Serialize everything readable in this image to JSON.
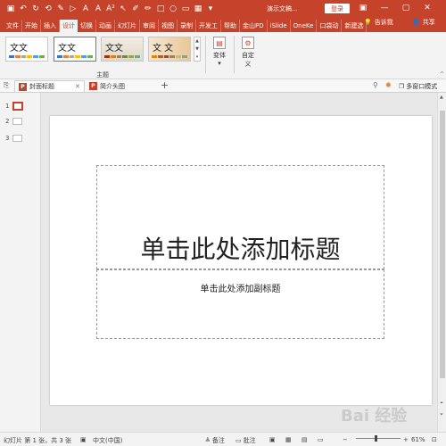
{
  "titlebar": {
    "doc_title": "演示文稿...",
    "login_label": "登录"
  },
  "tabs": [
    {
      "label": "文件"
    },
    {
      "label": "开始"
    },
    {
      "label": "插入"
    },
    {
      "label": "设计"
    },
    {
      "label": "切换"
    },
    {
      "label": "动画"
    },
    {
      "label": "幻灯片"
    },
    {
      "label": "审阅"
    },
    {
      "label": "视图"
    },
    {
      "label": "录制"
    },
    {
      "label": "开发工"
    },
    {
      "label": "帮助"
    },
    {
      "label": "金山PD"
    },
    {
      "label": "iSlide"
    },
    {
      "label": "OneKe"
    },
    {
      "label": "口袋动"
    },
    {
      "label": "新建选"
    }
  ],
  "tell_me": "告诉我",
  "share": "共享",
  "ribbon": {
    "themes": [
      {
        "text": "文文",
        "selected": false
      },
      {
        "text": "文文",
        "selected": true
      },
      {
        "text": "文文",
        "selected": false
      },
      {
        "text": "文 文",
        "selected": false
      }
    ],
    "theme_group_label": "主题",
    "variant_label": "变体",
    "customize_label_1": "自定",
    "customize_label_2": "义"
  },
  "doc_tabs": [
    {
      "label": "封面标题",
      "active": true
    },
    {
      "label": "简介头图",
      "active": false
    }
  ],
  "doc_tab_add": "+",
  "multi_window": "多窗口模式",
  "thumbnails": [
    {
      "number": "1"
    },
    {
      "number": "2"
    },
    {
      "number": "3"
    }
  ],
  "slide": {
    "title_placeholder": "单击此处添加标题",
    "subtitle_placeholder": "单击此处添加副标题"
  },
  "statusbar": {
    "slide_info": "幻灯片 第 1 张，共 3 张",
    "language": "中文(中国)",
    "notes": "备注",
    "comments": "批注",
    "zoom": "61%"
  },
  "colors": {
    "accent": "#c5432b",
    "ribbon_bg": "#f3f3f3",
    "canvas_bg": "#e8e8e8"
  }
}
